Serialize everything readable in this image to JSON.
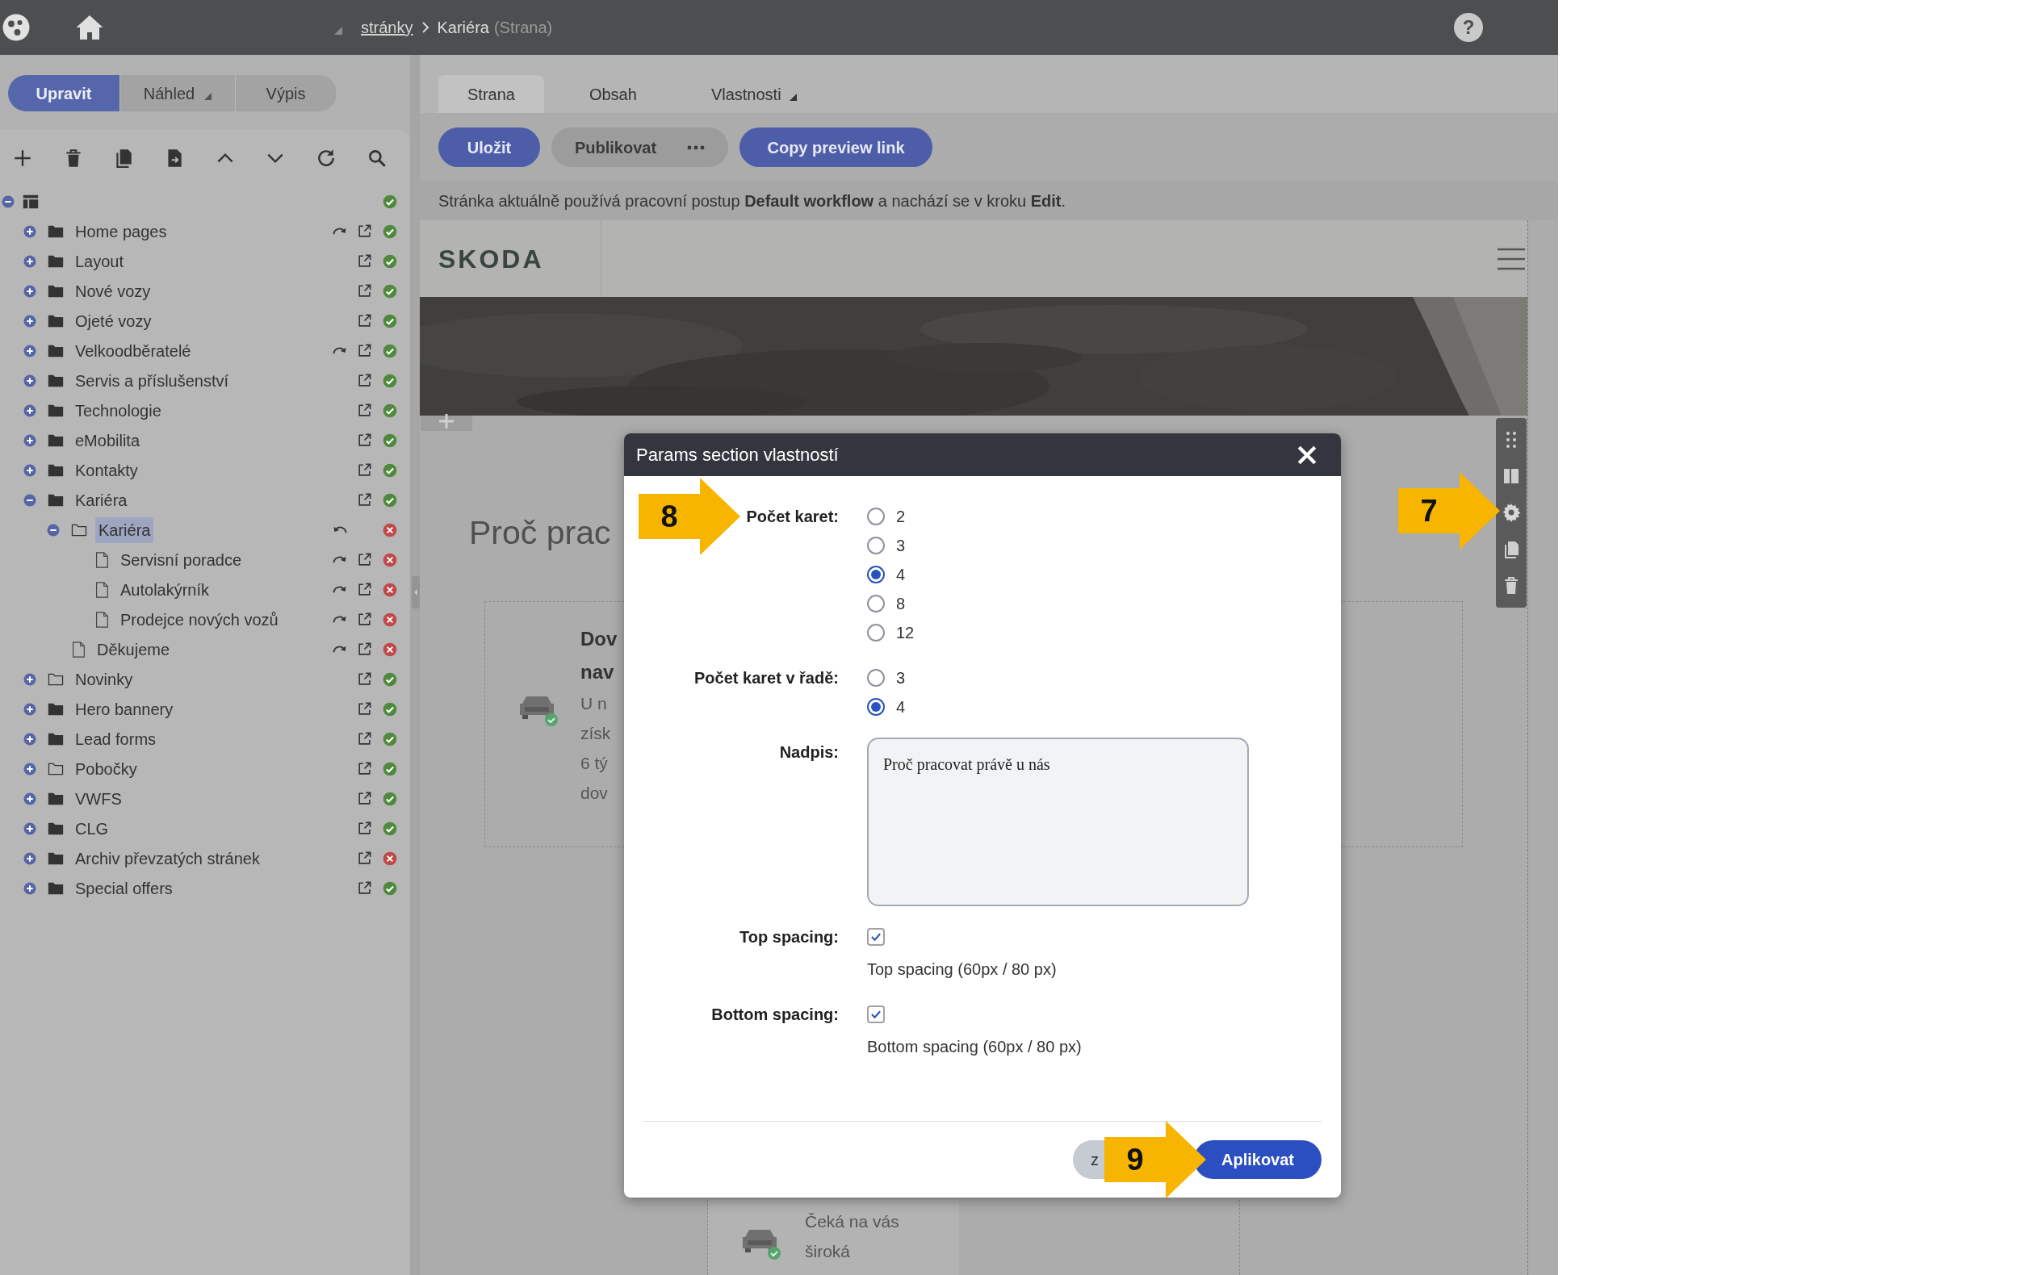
{
  "top_bar": {
    "breadcrumb_link": "stránky",
    "breadcrumb_current": "Kariéra",
    "breadcrumb_type": "(Strana)",
    "help": "?"
  },
  "mode_tabs": [
    {
      "label": "Upravit",
      "selected": true,
      "dropdown": false
    },
    {
      "label": "Náhled",
      "selected": false,
      "dropdown": true
    },
    {
      "label": "Výpis",
      "selected": false,
      "dropdown": false
    }
  ],
  "tree": {
    "root": {
      "expanded": true,
      "ok": true
    },
    "items": [
      {
        "label": "Home pages",
        "kind": "folder",
        "expanded": false,
        "selected": false,
        "redo": true,
        "undo": false,
        "link": true,
        "ok": true
      },
      {
        "label": "Layout",
        "kind": "folder",
        "expanded": false,
        "selected": false,
        "redo": false,
        "undo": false,
        "link": true,
        "ok": true
      },
      {
        "label": "Nové vozy",
        "kind": "folder",
        "expanded": false,
        "selected": false,
        "redo": false,
        "undo": false,
        "link": true,
        "ok": true
      },
      {
        "label": "Ojeté vozy",
        "kind": "folder",
        "expanded": false,
        "selected": false,
        "redo": false,
        "undo": false,
        "link": true,
        "ok": true
      },
      {
        "label": "Velkoodběratelé",
        "kind": "folder",
        "expanded": false,
        "selected": false,
        "redo": true,
        "undo": false,
        "link": true,
        "ok": true
      },
      {
        "label": "Servis a příslušenství",
        "kind": "folder",
        "expanded": false,
        "selected": false,
        "redo": false,
        "undo": false,
        "link": true,
        "ok": true
      },
      {
        "label": "Technologie",
        "kind": "folder",
        "expanded": false,
        "selected": false,
        "redo": false,
        "undo": false,
        "link": true,
        "ok": true
      },
      {
        "label": "eMobilita",
        "kind": "folder",
        "expanded": false,
        "selected": false,
        "redo": false,
        "undo": false,
        "link": true,
        "ok": true
      },
      {
        "label": "Kontakty",
        "kind": "folder",
        "expanded": false,
        "selected": false,
        "redo": false,
        "undo": false,
        "link": true,
        "ok": true
      },
      {
        "label": "Kariéra",
        "kind": "folder",
        "expanded": true,
        "selected": false,
        "redo": false,
        "undo": false,
        "link": true,
        "ok": true,
        "children": [
          {
            "label": "Kariéra",
            "kind": "folder-outline",
            "expanded": true,
            "selected": true,
            "redo": false,
            "undo": true,
            "link": false,
            "ok": false,
            "children": [
              {
                "label": "Servisní poradce",
                "kind": "page",
                "selected": false,
                "redo": true,
                "undo": false,
                "link": true,
                "ok": false
              },
              {
                "label": "Autolakýrník",
                "kind": "page",
                "selected": false,
                "redo": true,
                "undo": false,
                "link": true,
                "ok": false
              },
              {
                "label": "Prodejce nových vozů",
                "kind": "page",
                "selected": false,
                "redo": true,
                "undo": false,
                "link": true,
                "ok": false
              }
            ]
          },
          {
            "label": "Děkujeme",
            "kind": "page",
            "selected": false,
            "redo": true,
            "undo": false,
            "link": true,
            "ok": false
          }
        ]
      },
      {
        "label": "Novinky",
        "kind": "folder-outline",
        "expanded": false,
        "selected": false,
        "redo": false,
        "undo": false,
        "link": true,
        "ok": true
      },
      {
        "label": "Hero bannery",
        "kind": "folder",
        "expanded": false,
        "selected": false,
        "redo": false,
        "undo": false,
        "link": true,
        "ok": true
      },
      {
        "label": "Lead forms",
        "kind": "folder",
        "expanded": false,
        "selected": false,
        "redo": false,
        "undo": false,
        "link": true,
        "ok": true
      },
      {
        "label": "Pobočky",
        "kind": "folder-outline",
        "expanded": false,
        "selected": false,
        "redo": false,
        "undo": false,
        "link": true,
        "ok": true
      },
      {
        "label": "VWFS",
        "kind": "folder",
        "expanded": false,
        "selected": false,
        "redo": false,
        "undo": false,
        "link": true,
        "ok": true
      },
      {
        "label": "CLG",
        "kind": "folder",
        "expanded": false,
        "selected": false,
        "redo": false,
        "undo": false,
        "link": true,
        "ok": true
      },
      {
        "label": "Archiv převzatých stránek",
        "kind": "folder",
        "expanded": false,
        "selected": false,
        "redo": false,
        "undo": false,
        "link": true,
        "ok": false
      },
      {
        "label": "Special offers",
        "kind": "folder",
        "expanded": false,
        "selected": false,
        "redo": false,
        "undo": false,
        "link": true,
        "ok": true
      }
    ]
  },
  "editor_tabs": [
    {
      "label": "Strana",
      "selected": true,
      "dropdown": false
    },
    {
      "label": "Obsah",
      "selected": false,
      "dropdown": false
    },
    {
      "label": "Vlastnosti",
      "selected": false,
      "dropdown": true
    }
  ],
  "actions": [
    {
      "label": "Uložit",
      "kind": "primary",
      "more": false
    },
    {
      "label": "Publikovat",
      "kind": "secondary",
      "more": true
    },
    {
      "label": "Copy preview link",
      "kind": "primary",
      "more": false
    }
  ],
  "workflow_notice": "Stránka aktuálně používá pracovní postup **Default workflow** a nachází se v kroku **Edit**.",
  "preview": {
    "logo": "SKODA",
    "heading": "Proč prac",
    "card_lines": [
      {
        "text": "Dov",
        "bold": true
      },
      {
        "text": "nav",
        "bold": true
      },
      {
        "text": "U n",
        "bold": false
      },
      {
        "text": "získ",
        "bold": false
      },
      {
        "text": "6 tý",
        "bold": false
      },
      {
        "text": "dov",
        "bold": false
      }
    ],
    "lower_card_lines": [
      "Čeká na vás",
      "široká"
    ]
  },
  "side_toolbar": {
    "callout": "7"
  },
  "dialog": {
    "title": "Params section vlastností",
    "fields": [
      {
        "kind": "radio",
        "label": "Počet karet:",
        "callout": "8",
        "options": [
          {
            "label": "2",
            "selected": false
          },
          {
            "label": "3",
            "selected": false
          },
          {
            "label": "4",
            "selected": true
          },
          {
            "label": "8",
            "selected": false
          },
          {
            "label": "12",
            "selected": false
          }
        ]
      },
      {
        "kind": "radio",
        "label": "Počet karet v řadě:",
        "options": [
          {
            "label": "3",
            "selected": false
          },
          {
            "label": "4",
            "selected": true
          }
        ]
      },
      {
        "kind": "textarea",
        "label": "Nadpis:",
        "value": "Proč pracovat právě u nás"
      },
      {
        "kind": "checkbox",
        "label": "Top spacing:",
        "checked": true,
        "description": "Top spacing (60px / 80 px)"
      },
      {
        "kind": "checkbox",
        "label": "Bottom spacing:",
        "checked": true,
        "description": "Bottom spacing (60px / 80 px)"
      }
    ],
    "buttons": [
      {
        "label": "z",
        "kind": "secondary"
      },
      {
        "label": "Aplikovat",
        "kind": "primary",
        "callout": "9"
      }
    ]
  }
}
